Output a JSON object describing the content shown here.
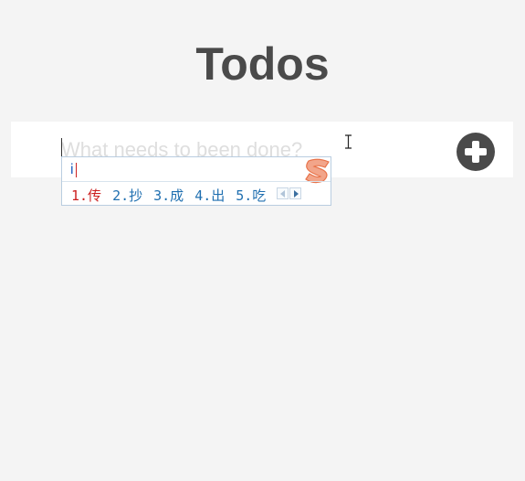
{
  "header": {
    "title": "Todos"
  },
  "todo_input": {
    "placeholder": "What needs to been done?",
    "value": ""
  },
  "add_button": {
    "icon": "plus-circle-icon",
    "color": "#4a4a4a"
  },
  "ime_popup": {
    "composition": "i",
    "logo": "sogou-s-logo-icon",
    "candidates": [
      {
        "label": "1.传"
      },
      {
        "label": "2.抄"
      },
      {
        "label": "3.成"
      },
      {
        "label": "4.出"
      },
      {
        "label": "5.吃"
      }
    ],
    "pager": {
      "prev_icon": "triangle-left-icon",
      "next_icon": "triangle-right-icon"
    },
    "colors": {
      "first_candidate": "#cc1f1f",
      "candidate": "#1f6fb0",
      "logo": "#e8734a"
    }
  },
  "cursor": {
    "icon": "text-cursor-icon"
  }
}
